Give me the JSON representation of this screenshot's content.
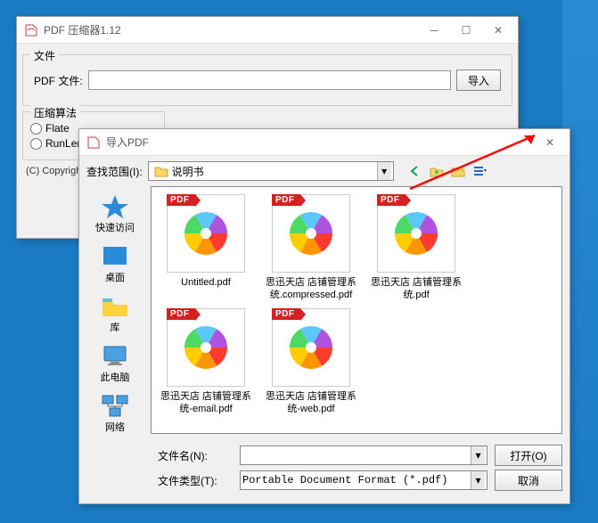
{
  "main_window": {
    "title": "PDF 压缩器1.12",
    "group_file": "文件",
    "pdf_file_label": "PDF 文件:",
    "pdf_file_value": "",
    "import_btn": "导入",
    "group_algo": "压缩算法",
    "radio_flate": "Flate",
    "radio_runlength": "RunLength",
    "copyright": "(C) Copyright"
  },
  "dialog": {
    "title": "导入PDF",
    "lookin_label": "查找范围(I):",
    "lookin_value": "说明书",
    "filename_label": "文件名(N):",
    "filename_value": "",
    "filetype_label": "文件类型(T):",
    "filetype_value": "Portable Document Format (*.pdf)",
    "open_btn": "打开(O)",
    "cancel_btn": "取消",
    "places": [
      {
        "id": "quick",
        "label": "快速访问"
      },
      {
        "id": "desktop",
        "label": "桌面"
      },
      {
        "id": "libraries",
        "label": "库"
      },
      {
        "id": "thispc",
        "label": "此电脑"
      },
      {
        "id": "network",
        "label": "网络"
      }
    ],
    "files": [
      {
        "badge": "PDF",
        "name": "Untitled.pdf"
      },
      {
        "badge": "PDF",
        "name": "思迅天店 店铺管理系统.compressed.pdf"
      },
      {
        "badge": "PDF",
        "name": "思迅天店 店铺管理系统.pdf"
      },
      {
        "badge": "PDF",
        "name": "思迅天店 店铺管理系统-email.pdf"
      },
      {
        "badge": "PDF",
        "name": "思迅天店 店铺管理系统-web.pdf"
      }
    ]
  }
}
